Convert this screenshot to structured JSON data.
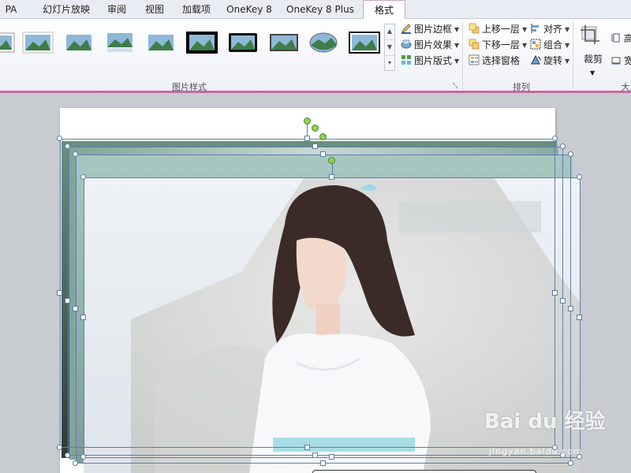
{
  "tabs": [
    {
      "label": "PA"
    },
    {
      "label": "幻灯片放映"
    },
    {
      "label": "审阅"
    },
    {
      "label": "视图"
    },
    {
      "label": "加载项"
    },
    {
      "label": "OneKey 8"
    },
    {
      "label": "OneKey 8 Plus"
    },
    {
      "label": "格式"
    }
  ],
  "active_tab": "格式",
  "picture_styles": {
    "group_label": "图片样式",
    "border_label": "图片边框",
    "effects_label": "图片效果",
    "layout_label": "图片版式"
  },
  "arrange": {
    "group_label": "排列",
    "bring_forward_label": "上移一层",
    "send_backward_label": "下移一层",
    "selection_pane_label": "选择窗格",
    "align_label": "对齐",
    "group_cmd_label": "组合",
    "rotate_label": "旋转"
  },
  "size": {
    "crop_label": "裁剪",
    "height_label": "高",
    "width_label": "宽",
    "group_label_partial": "大"
  },
  "watermark": {
    "main": "Bai du 经验",
    "sub": "jingyan.baidu.com"
  },
  "colors": {
    "accent": "#c36aa5",
    "selection": "#5d7ea8",
    "rotate_handle": "#8fd14f"
  }
}
